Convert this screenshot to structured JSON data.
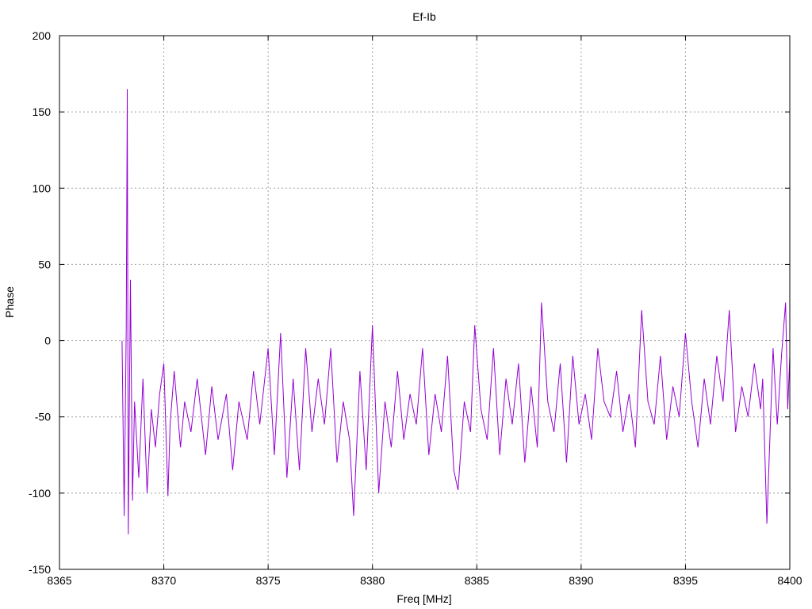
{
  "chart_data": {
    "type": "line",
    "title": "Ef-Ib",
    "xlabel": "Freq [MHz]",
    "ylabel": "Phase",
    "xlim": [
      8365,
      8400
    ],
    "ylim": [
      -150,
      200
    ],
    "xticks": [
      8365,
      8370,
      8375,
      8380,
      8385,
      8390,
      8395,
      8400
    ],
    "yticks": [
      -150,
      -100,
      -50,
      0,
      50,
      100,
      150,
      200
    ],
    "grid": true,
    "legend": "none",
    "series": [
      {
        "color": "#9400d3",
        "x": [
          8368.0,
          8368.1,
          8368.2,
          8368.25,
          8368.3,
          8368.4,
          8368.5,
          8368.6,
          8368.8,
          8369.0,
          8369.2,
          8369.4,
          8369.6,
          8369.8,
          8370.0,
          8370.2,
          8370.3,
          8370.5,
          8370.8,
          8371.0,
          8371.3,
          8371.6,
          8372.0,
          8372.3,
          8372.6,
          8373.0,
          8373.3,
          8373.6,
          8374.0,
          8374.3,
          8374.6,
          8375.0,
          8375.3,
          8375.6,
          8375.9,
          8376.2,
          8376.5,
          8376.8,
          8377.1,
          8377.4,
          8377.7,
          8378.0,
          8378.3,
          8378.6,
          8378.9,
          8379.1,
          8379.4,
          8379.7,
          8380.0,
          8380.3,
          8380.6,
          8380.9,
          8381.2,
          8381.5,
          8381.8,
          8382.1,
          8382.4,
          8382.7,
          8383.0,
          8383.3,
          8383.6,
          8383.9,
          8384.1,
          8384.4,
          8384.7,
          8384.9,
          8385.2,
          8385.5,
          8385.8,
          8386.1,
          8386.4,
          8386.7,
          8387.0,
          8387.3,
          8387.6,
          8387.9,
          8388.1,
          8388.4,
          8388.7,
          8389.0,
          8389.3,
          8389.6,
          8389.9,
          8390.2,
          8390.5,
          8390.8,
          8391.1,
          8391.4,
          8391.7,
          8392.0,
          8392.3,
          8392.6,
          8392.9,
          8393.2,
          8393.5,
          8393.8,
          8394.1,
          8394.4,
          8394.7,
          8395.0,
          8395.3,
          8395.6,
          8395.9,
          8396.2,
          8396.5,
          8396.8,
          8397.1,
          8397.4,
          8397.7,
          8398.0,
          8398.3,
          8398.6,
          8398.7,
          8398.9,
          8399.2,
          8399.4,
          8399.6,
          8399.8,
          8399.9,
          8400.0
        ],
        "y": [
          0,
          -115,
          8,
          165,
          -127,
          40,
          -105,
          -40,
          -90,
          -25,
          -100,
          -45,
          -70,
          -35,
          -15,
          -102,
          -55,
          -20,
          -70,
          -40,
          -60,
          -25,
          -75,
          -30,
          -65,
          -35,
          -85,
          -40,
          -65,
          -20,
          -55,
          -5,
          -75,
          5,
          -90,
          -25,
          -85,
          -5,
          -60,
          -25,
          -55,
          -5,
          -80,
          -40,
          -65,
          -115,
          -20,
          -85,
          10,
          -100,
          -40,
          -70,
          -20,
          -65,
          -35,
          -55,
          -5,
          -75,
          -35,
          -60,
          -10,
          -85,
          -98,
          -40,
          -60,
          10,
          -45,
          -65,
          -5,
          -75,
          -25,
          -55,
          -15,
          -80,
          -30,
          -70,
          25,
          -40,
          -60,
          -15,
          -80,
          -10,
          -55,
          -35,
          -65,
          -5,
          -40,
          -50,
          -20,
          -60,
          -35,
          -70,
          20,
          -40,
          -55,
          -10,
          -65,
          -30,
          -50,
          5,
          -40,
          -70,
          -25,
          -55,
          -10,
          -40,
          20,
          -60,
          -30,
          -50,
          -15,
          -45,
          -25,
          -120,
          -5,
          -55,
          -10,
          25,
          -45,
          -10
        ]
      }
    ]
  }
}
